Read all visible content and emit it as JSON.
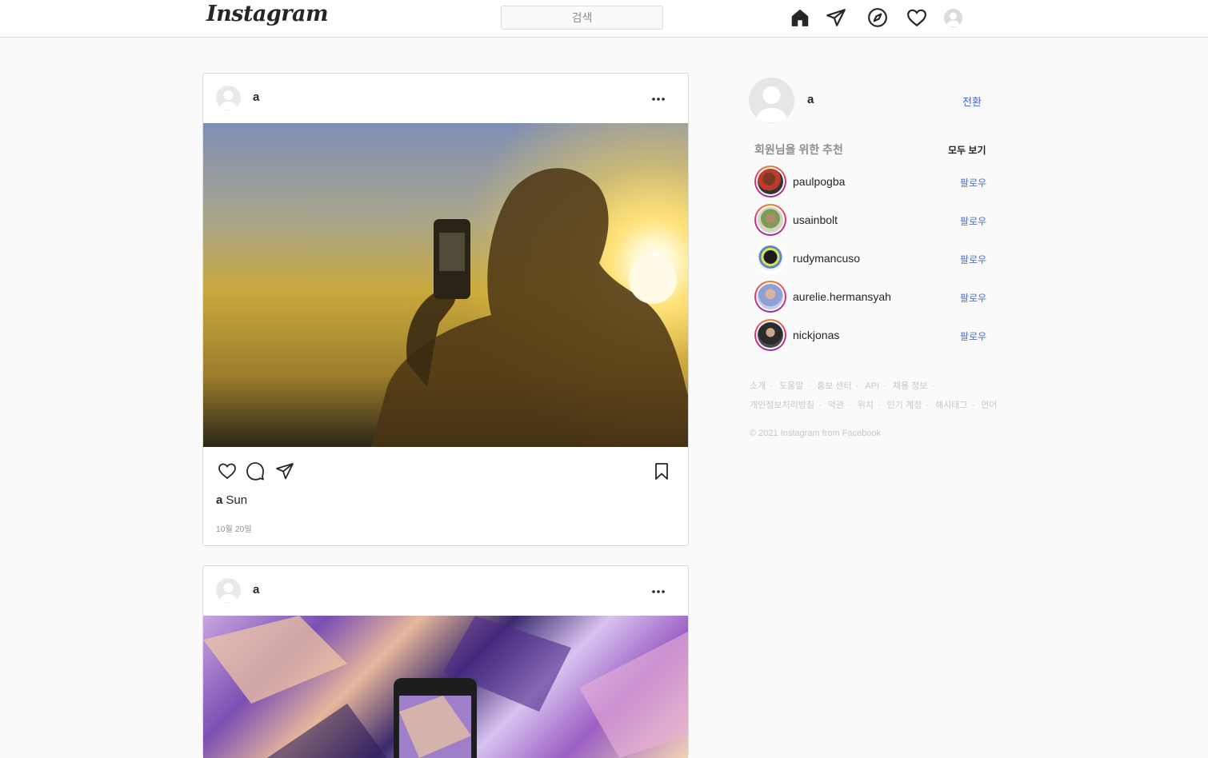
{
  "header": {
    "logo": "Instagram",
    "search_placeholder": "검색",
    "icons": [
      "home-icon",
      "direct-message-icon",
      "explore-icon",
      "activity-heart-icon",
      "profile-avatar"
    ]
  },
  "posts": [
    {
      "username": "a",
      "caption_user": "a",
      "caption_text": "Sun",
      "date": "10월 20일"
    },
    {
      "username": "a"
    }
  ],
  "sidebar": {
    "me": {
      "username": "a",
      "switch_label": "전환"
    },
    "suggestions_title": "회원님을 위한 추천",
    "see_all_label": "모두 보기",
    "suggestions": [
      {
        "username": "paulpogba",
        "follow_label": "팔로우"
      },
      {
        "username": "usainbolt",
        "follow_label": "팔로우"
      },
      {
        "username": "rudymancuso",
        "follow_label": "팔로우"
      },
      {
        "username": "aurelie.hermansyah",
        "follow_label": "팔로우"
      },
      {
        "username": "nickjonas",
        "follow_label": "팔로우"
      }
    ],
    "footer_row1": [
      "소개",
      "도움말",
      "홍보 센터",
      "API",
      "채용 정보"
    ],
    "footer_row2": [
      "개인정보처리방침",
      "약관",
      "위치",
      "인기 계정",
      "해시태그",
      "언어"
    ],
    "copyright": "© 2021 Instagram from Facebook"
  },
  "colors": {
    "link": "#4a6fd6",
    "border": "#dbdbdb",
    "muted": "#8e8e8e"
  }
}
